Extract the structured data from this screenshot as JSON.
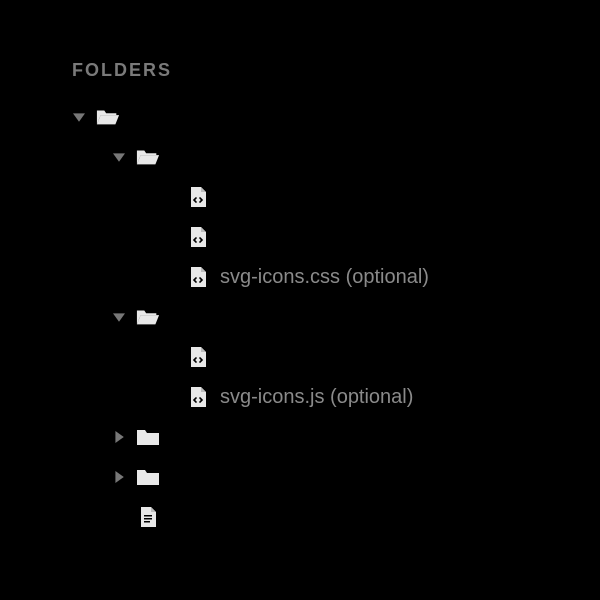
{
  "header": "FOLDERS",
  "tree": [
    {
      "depth": 0,
      "kind": "folder-open",
      "arrow": "down",
      "label": ""
    },
    {
      "depth": 1,
      "kind": "folder-open",
      "arrow": "down",
      "label": ""
    },
    {
      "depth": 2,
      "kind": "file-code",
      "arrow": "",
      "label": ""
    },
    {
      "depth": 2,
      "kind": "file-code",
      "arrow": "",
      "label": ""
    },
    {
      "depth": 2,
      "kind": "file-code",
      "arrow": "",
      "label": "svg-icons.css (optional)"
    },
    {
      "depth": 1,
      "kind": "folder-open",
      "arrow": "down",
      "label": ""
    },
    {
      "depth": 2,
      "kind": "file-code",
      "arrow": "",
      "label": ""
    },
    {
      "depth": 2,
      "kind": "file-code",
      "arrow": "",
      "label": "svg-icons.js (optional)"
    },
    {
      "depth": 1,
      "kind": "folder",
      "arrow": "right",
      "label": ""
    },
    {
      "depth": 1,
      "kind": "folder",
      "arrow": "right",
      "label": ""
    },
    {
      "depth": 1,
      "kind": "file-text",
      "arrow": "",
      "label": ""
    }
  ]
}
